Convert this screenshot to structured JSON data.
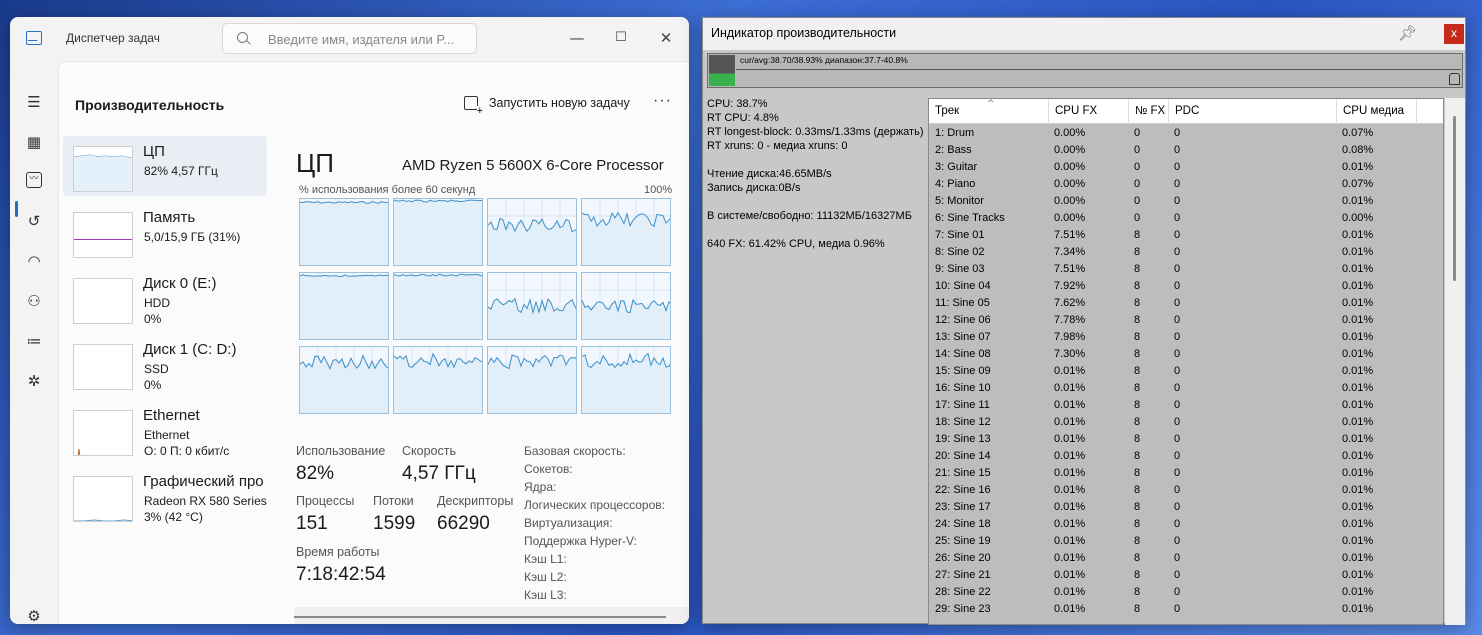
{
  "task_manager": {
    "title": "Диспетчер задач",
    "search_placeholder": "Введите имя, издателя или P...",
    "window_controls": {
      "minimize": "—",
      "maximize": "☐",
      "close": "✕"
    },
    "page_title": "Производительность",
    "new_task_label": "Запустить новую задачу",
    "more_label": "···",
    "nav_icons": [
      "hamburger-menu-icon",
      "processes-icon",
      "performance-icon",
      "app-history-icon",
      "startup-apps-icon",
      "users-icon",
      "details-icon",
      "services-icon",
      "settings-icon"
    ],
    "resources": [
      {
        "name": "ЦП",
        "sub1": "82% 4,57 ГГц",
        "sub2": ""
      },
      {
        "name": "Память",
        "sub1": "5,0/15,9 ГБ (31%)",
        "sub2": ""
      },
      {
        "name": "Диск 0 (E:)",
        "sub1": "HDD",
        "sub2": "0%"
      },
      {
        "name": "Диск 1 (C: D:)",
        "sub1": "SSD",
        "sub2": "0%"
      },
      {
        "name": "Ethernet",
        "sub1": "Ethernet",
        "sub2": "О: 0 П: 0 кбит/с"
      },
      {
        "name": "Графический про",
        "sub1": "Radeon RX 580 Series",
        "sub2": "3% (42 °C)"
      }
    ],
    "cpu": {
      "heading": "ЦП",
      "model": "AMD Ryzen 5 5600X 6-Core Processor",
      "graph_caption": "% использования более 60 секунд",
      "graph_max": "100%",
      "core_levels": [
        0.95,
        0.97,
        0.62,
        0.7,
        0.96,
        0.97,
        0.52,
        0.52,
        0.78,
        0.8,
        0.78,
        0.8
      ],
      "stats": {
        "usage_label": "Использование",
        "usage_value": "82%",
        "speed_label": "Скорость",
        "speed_value": "4,57 ГГц",
        "processes_label": "Процессы",
        "processes_value": "151",
        "threads_label": "Потоки",
        "threads_value": "1599",
        "handles_label": "Дескрипторы",
        "handles_value": "66290",
        "uptime_label": "Время работы",
        "uptime_value": "7:18:42:54"
      },
      "specs": [
        "Базовая скорость:",
        "Сокетов:",
        "Ядра:",
        "Логических процессоров:",
        "Виртуализация:",
        "Поддержка Hyper-V:",
        "Кэш L1:",
        "Кэш L2:",
        "Кэш L3:"
      ]
    }
  },
  "perf_meter": {
    "title": "Индикатор производительности",
    "pin_icon": "pin-icon",
    "close_label": "x",
    "meter_text": "cur/avg:38.70/38.93%  диапазон:37.7-40.8%",
    "stats": [
      "CPU: 38.7%",
      "RT CPU: 4.8%",
      "RT longest-block: 0.33ms/1.33ms (держать)",
      "RT xruns: 0 - медиа xruns: 0",
      "",
      "Чтение диска:46.65MB/s",
      "Запись диска:0B/s",
      "",
      "В системе/свободно: 11132МБ/16327МБ",
      "",
      "640 FX: 61.42% CPU, медиа 0.96%"
    ],
    "columns": [
      "Трек",
      "CPU FX",
      "№ FX",
      "PDC",
      "CPU медиа"
    ],
    "rows": [
      [
        "1: Drum",
        "0.00%",
        "0",
        "0",
        "0.07%"
      ],
      [
        "2: Bass",
        "0.00%",
        "0",
        "0",
        "0.08%"
      ],
      [
        "3: Guitar",
        "0.00%",
        "0",
        "0",
        "0.01%"
      ],
      [
        "4: Piano",
        "0.00%",
        "0",
        "0",
        "0.07%"
      ],
      [
        "5: Monitor",
        "0.00%",
        "0",
        "0",
        "0.01%"
      ],
      [
        "6: Sine Tracks",
        "0.00%",
        "0",
        "0",
        "0.00%"
      ],
      [
        "7: Sine 01",
        "7.51%",
        "8",
        "0",
        "0.01%"
      ],
      [
        "8: Sine 02",
        "7.34%",
        "8",
        "0",
        "0.01%"
      ],
      [
        "9: Sine 03",
        "7.51%",
        "8",
        "0",
        "0.01%"
      ],
      [
        "10: Sine 04",
        "7.92%",
        "8",
        "0",
        "0.01%"
      ],
      [
        "11: Sine 05",
        "7.62%",
        "8",
        "0",
        "0.01%"
      ],
      [
        "12: Sine 06",
        "7.78%",
        "8",
        "0",
        "0.01%"
      ],
      [
        "13: Sine 07",
        "7.98%",
        "8",
        "0",
        "0.01%"
      ],
      [
        "14: Sine 08",
        "7.30%",
        "8",
        "0",
        "0.01%"
      ],
      [
        "15: Sine 09",
        "0.01%",
        "8",
        "0",
        "0.01%"
      ],
      [
        "16: Sine 10",
        "0.01%",
        "8",
        "0",
        "0.01%"
      ],
      [
        "17: Sine 11",
        "0.01%",
        "8",
        "0",
        "0.01%"
      ],
      [
        "18: Sine 12",
        "0.01%",
        "8",
        "0",
        "0.01%"
      ],
      [
        "19: Sine 13",
        "0.01%",
        "8",
        "0",
        "0.01%"
      ],
      [
        "20: Sine 14",
        "0.01%",
        "8",
        "0",
        "0.01%"
      ],
      [
        "21: Sine 15",
        "0.01%",
        "8",
        "0",
        "0.01%"
      ],
      [
        "22: Sine 16",
        "0.01%",
        "8",
        "0",
        "0.01%"
      ],
      [
        "23: Sine 17",
        "0.01%",
        "8",
        "0",
        "0.01%"
      ],
      [
        "24: Sine 18",
        "0.01%",
        "8",
        "0",
        "0.01%"
      ],
      [
        "25: Sine 19",
        "0.01%",
        "8",
        "0",
        "0.01%"
      ],
      [
        "26: Sine 20",
        "0.01%",
        "8",
        "0",
        "0.01%"
      ],
      [
        "27: Sine 21",
        "0.01%",
        "8",
        "0",
        "0.01%"
      ],
      [
        "28: Sine 22",
        "0.01%",
        "8",
        "0",
        "0.01%"
      ],
      [
        "29: Sine 23",
        "0.01%",
        "8",
        "0",
        "0.01%"
      ]
    ]
  }
}
